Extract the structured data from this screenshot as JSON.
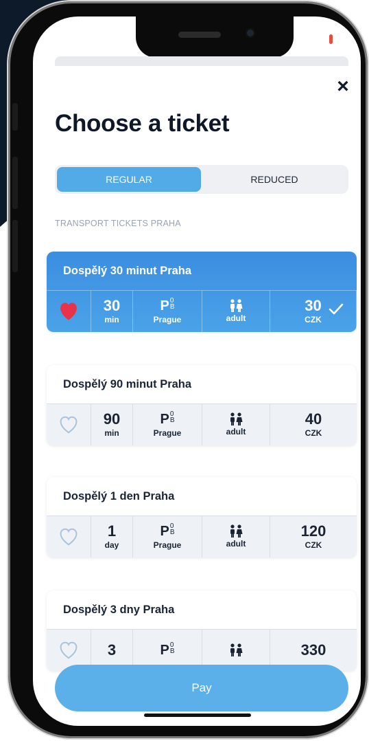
{
  "header": {
    "close_icon": "close-icon",
    "title": "Choose a ticket"
  },
  "segmented": {
    "regular": "REGULAR",
    "reduced": "REDUCED"
  },
  "section_label": "TRANSPORT TICKETS PRAHA",
  "tickets": [
    {
      "name": "Dospělý 30 minut Praha",
      "duration": "30",
      "duration_unit": "min",
      "zone_letter": "P",
      "zone_sup": "0",
      "zone_sub": "B",
      "zone_label": "Prague",
      "passenger": "adult",
      "price": "30",
      "currency": "CZK",
      "selected": true,
      "favorite": true
    },
    {
      "name": "Dospělý 90 minut Praha",
      "duration": "90",
      "duration_unit": "min",
      "zone_letter": "P",
      "zone_sup": "0",
      "zone_sub": "B",
      "zone_label": "Prague",
      "passenger": "adult",
      "price": "40",
      "currency": "CZK",
      "selected": false,
      "favorite": false
    },
    {
      "name": "Dospělý 1 den Praha",
      "duration": "1",
      "duration_unit": "day",
      "zone_letter": "P",
      "zone_sup": "0",
      "zone_sub": "B",
      "zone_label": "Prague",
      "passenger": "adult",
      "price": "120",
      "currency": "CZK",
      "selected": false,
      "favorite": false
    },
    {
      "name": "Dospělý 3 dny Praha",
      "duration": "3",
      "zone_letter": "P",
      "zone_sup": "0",
      "zone_sub": "B",
      "price": "330",
      "selected": false,
      "favorite": false
    }
  ],
  "pay_button": "Pay",
  "colors": {
    "accent": "#52abe6",
    "selected_card": "#3c8de0",
    "heart": "#e8334a"
  }
}
